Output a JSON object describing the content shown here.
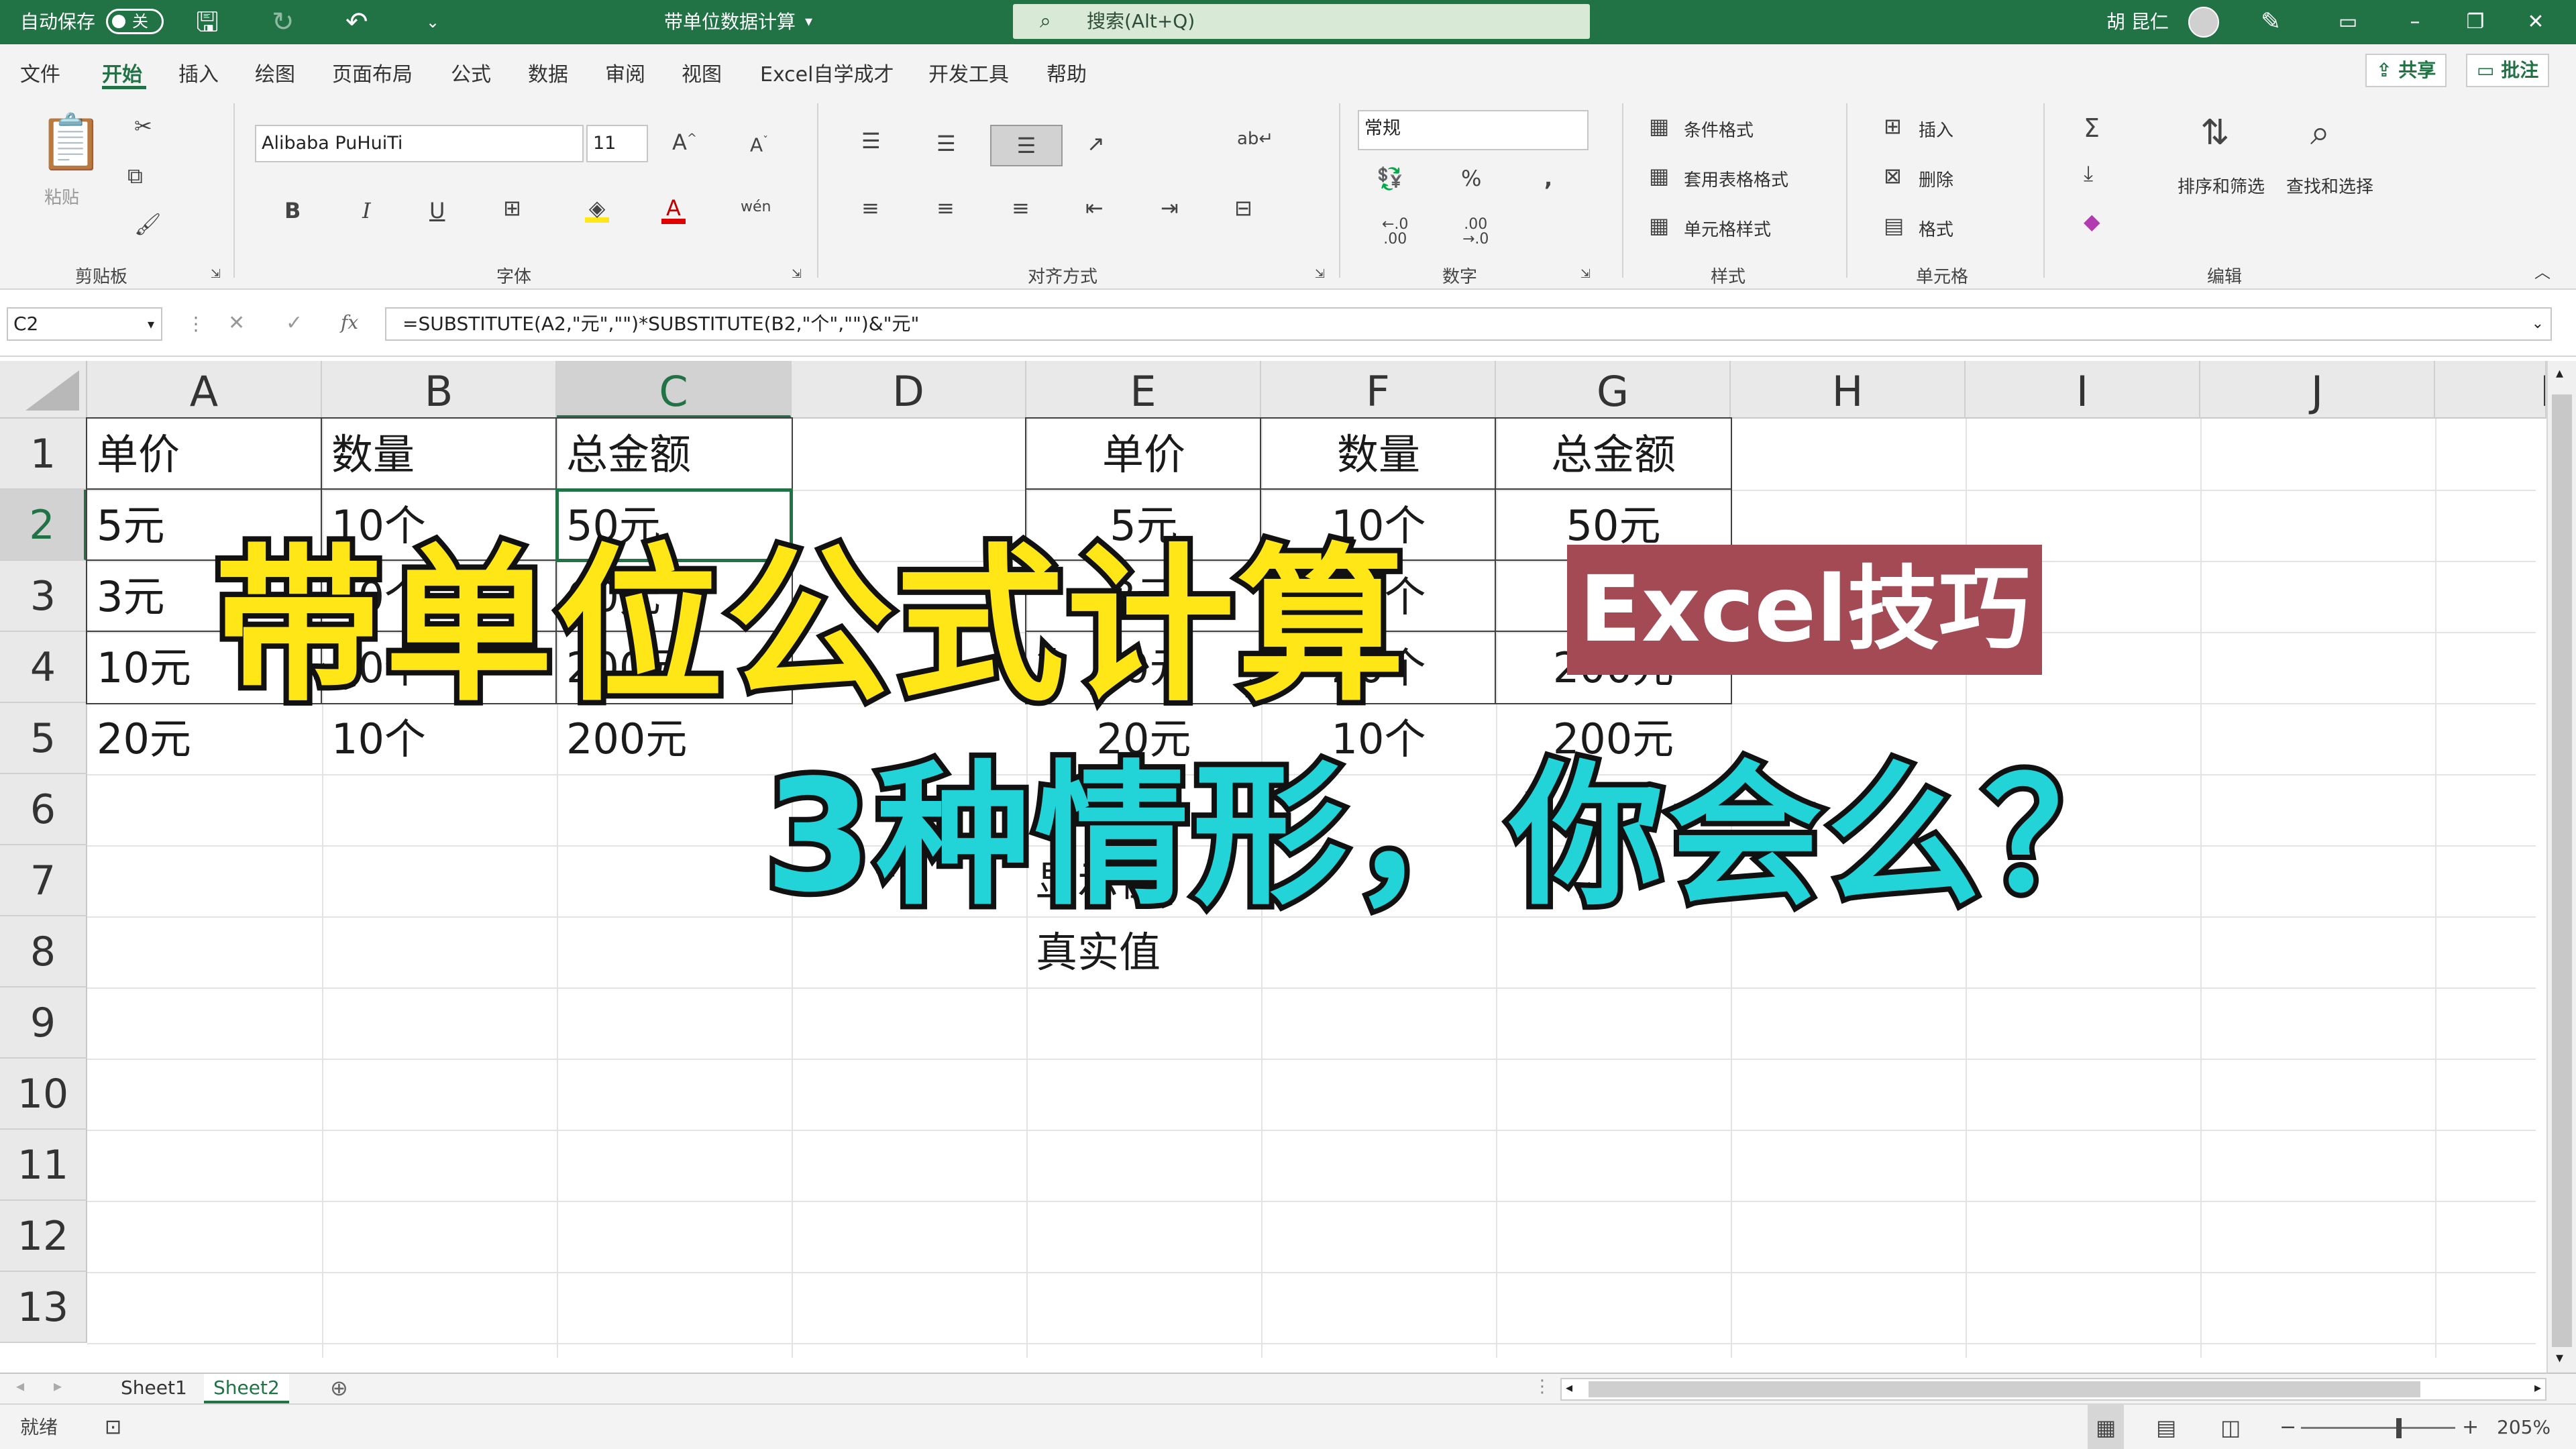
{
  "titlebar": {
    "autosave_label": "自动保存",
    "autosave_state": "关",
    "doc_title": "带单位数据计算",
    "search_placeholder": "搜索(Alt+Q)",
    "user_name": "胡 昆仁"
  },
  "menu": {
    "tabs": [
      "文件",
      "开始",
      "插入",
      "绘图",
      "页面布局",
      "公式",
      "数据",
      "审阅",
      "视图",
      "Excel自学成才",
      "开发工具",
      "帮助"
    ],
    "active_tab": "开始",
    "share": "共享",
    "comments": "批注"
  },
  "ribbon": {
    "clipboard": {
      "paste": "粘贴",
      "group": "剪贴板"
    },
    "font": {
      "family": "Alibaba PuHuiTi",
      "size": "11",
      "bold": "B",
      "italic": "I",
      "underline": "U",
      "grow": "A^",
      "shrink": "Aˇ",
      "group": "字体"
    },
    "alignment": {
      "group": "对齐方式"
    },
    "number": {
      "format": "常规",
      "group": "数字"
    },
    "styles": {
      "conditional": "条件格式",
      "table": "套用表格格式",
      "cell": "单元格样式",
      "group": "样式"
    },
    "cells": {
      "insert": "插入",
      "delete": "删除",
      "format": "格式",
      "group": "单元格"
    },
    "editing": {
      "sort": "排序和筛选",
      "find": "查找和选择",
      "group": "编辑"
    }
  },
  "formula_bar": {
    "name_box": "C2",
    "fx": "fx",
    "formula": "=SUBSTITUTE(A2,\"元\",\"\")*SUBSTITUTE(B2,\"个\",\"\")&\"元\""
  },
  "grid": {
    "columns": [
      "A",
      "B",
      "C",
      "D",
      "E",
      "F",
      "G",
      "H",
      "I",
      "J",
      "K"
    ],
    "rows": [
      "1",
      "2",
      "3",
      "4",
      "5",
      "6",
      "7",
      "8",
      "9",
      "10",
      "11",
      "12",
      "13"
    ],
    "selected_cell": "C2",
    "cells": {
      "A1": "单价",
      "B1": "数量",
      "C1": "总金额",
      "A2": "5元",
      "B2": "10个",
      "C2": "50元",
      "A3": "3元",
      "B3": "20个",
      "C3": "60元",
      "A4": "10元",
      "B4": "20个",
      "C4": "200元",
      "A5": "20元",
      "B5": "10个",
      "C5": "200元",
      "E1": "单价",
      "F1": "数量",
      "G1": "总金额",
      "E2": "5元",
      "F2": "10个",
      "G2": "50元",
      "E3": "3元",
      "F3": "20个",
      "G3": "60元",
      "E4": "10元",
      "F4": "20个",
      "G4": "200元",
      "E5": "20元",
      "F5": "10个",
      "G5": "200元",
      "E7": "显示值",
      "E8": "真实值"
    }
  },
  "overlay": {
    "title": "带单位公式计算",
    "badge": "Excel技巧",
    "subtitle": "3种情形，你会么？",
    "title_color": "#FFE617",
    "subtitle_color": "#22D3D8",
    "badge_color": "#A34A55"
  },
  "sheets": {
    "tabs": [
      "Sheet1",
      "Sheet2"
    ],
    "active": "Sheet2"
  },
  "status": {
    "ready": "就绪",
    "zoom": "205%"
  },
  "colors": {
    "accent": "#217346",
    "titlebar": "#217346"
  }
}
